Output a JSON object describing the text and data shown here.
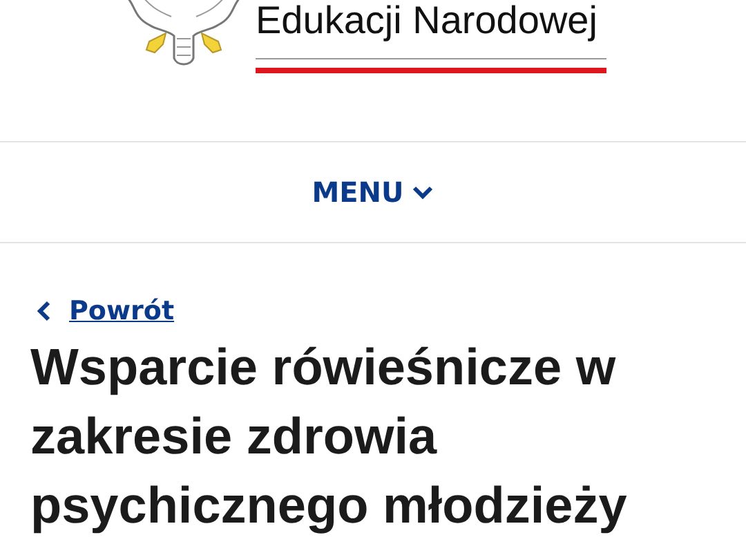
{
  "header": {
    "logo_text": "Edukacji Narodowej"
  },
  "menu": {
    "label": "MENU",
    "expanded": false
  },
  "back_link": {
    "label": "Powrót"
  },
  "title": "Wsparcie rówieśnicze w zakresie zdrowia psychicznego młodzieży"
}
